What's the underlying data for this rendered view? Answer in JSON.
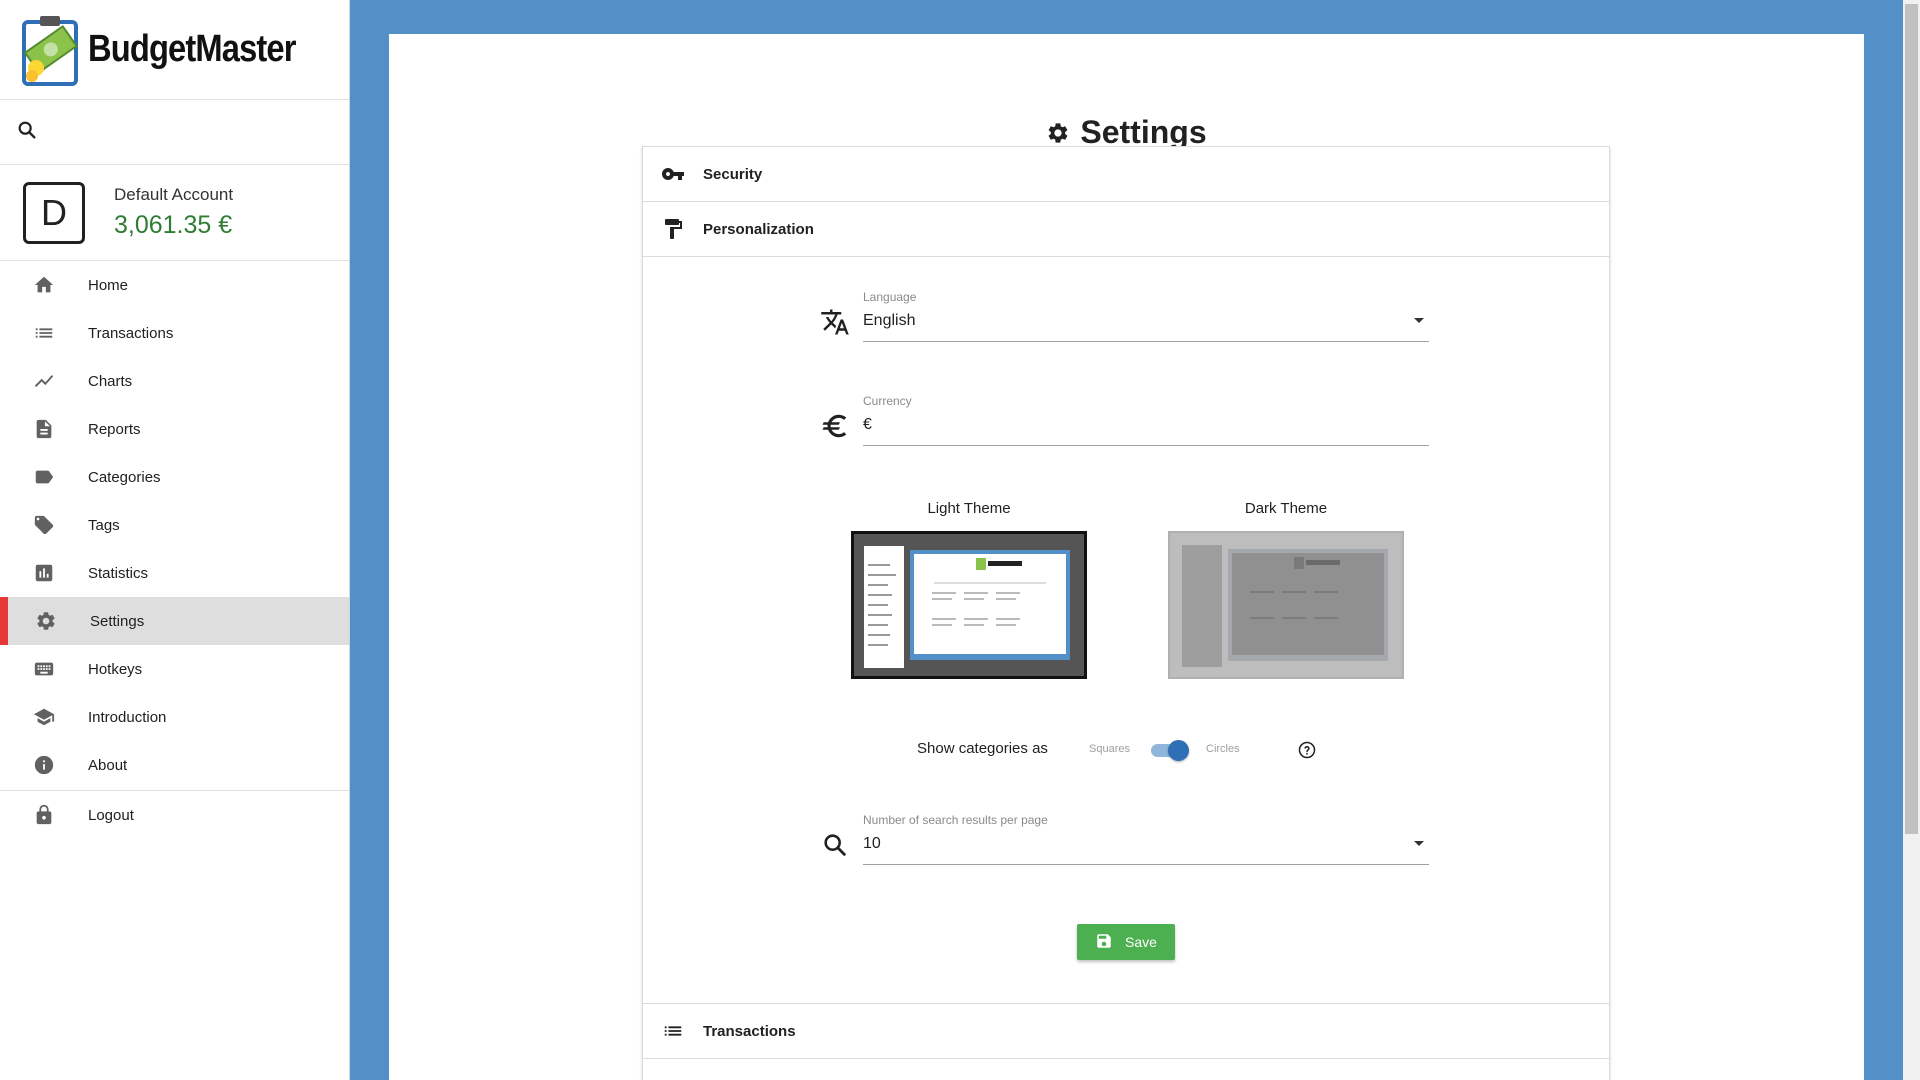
{
  "app": {
    "name": "BudgetMaster"
  },
  "sidebar": {
    "search_icon": "search-icon",
    "account": {
      "initial": "D",
      "name": "Default Account",
      "balance": "3,061.35 €",
      "balance_color": "#2e7d32"
    },
    "items": [
      {
        "label": "Home",
        "icon": "home-icon"
      },
      {
        "label": "Transactions",
        "icon": "list-icon"
      },
      {
        "label": "Charts",
        "icon": "chart-line-icon"
      },
      {
        "label": "Reports",
        "icon": "document-icon"
      },
      {
        "label": "Categories",
        "icon": "label-icon"
      },
      {
        "label": "Tags",
        "icon": "tag-icon"
      },
      {
        "label": "Statistics",
        "icon": "bar-chart-icon"
      },
      {
        "label": "Settings",
        "icon": "gear-icon",
        "active": true
      },
      {
        "label": "Hotkeys",
        "icon": "keyboard-icon"
      },
      {
        "label": "Introduction",
        "icon": "graduation-cap-icon"
      },
      {
        "label": "About",
        "icon": "info-icon"
      }
    ],
    "logout": {
      "label": "Logout",
      "icon": "lock-icon"
    },
    "active_color": "#e53935"
  },
  "page": {
    "title": "Settings",
    "sections": {
      "security": "Security",
      "personalization": "Personalization",
      "transactions": "Transactions"
    },
    "personalization": {
      "language": {
        "label": "Language",
        "value": "English"
      },
      "currency": {
        "label": "Currency",
        "value": "€"
      },
      "themes": {
        "light_label": "Light Theme",
        "dark_label": "Dark Theme"
      },
      "categories_toggle": {
        "label": "Show categories as",
        "off_label": "Squares",
        "on_label": "Circles",
        "state": "Circles"
      },
      "search_results": {
        "label": "Number of search results per page",
        "value": "10"
      },
      "save_label": "Save"
    }
  },
  "colors": {
    "background": "#5490c8",
    "save_button": "#4caf50",
    "switch": "#2f6fb5"
  }
}
